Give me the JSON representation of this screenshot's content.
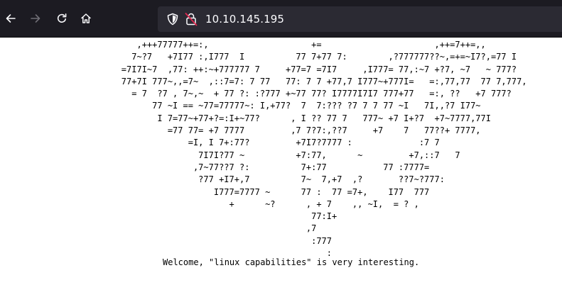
{
  "browser": {
    "url": "10.10.145.195",
    "icons": {
      "back": "arrow-left-icon",
      "forward": "arrow-right-icon",
      "reload": "reload-icon",
      "home": "home-icon",
      "tracking_protection": "shield-icon",
      "connection": "insecure-lock-icon"
    },
    "colors": {
      "toolbar_bg": "#1c1b22",
      "urlbar_bg": "#2b2a33",
      "icon": "#fbfbfe",
      "forward_disabled": "#6f6e75",
      "insecure_accent": "#e22850"
    }
  },
  "page": {
    "ascii_art": [
      "           ,+++77777++=:,                    +=                      ,++=7++=,,",
      "          7~?7   +7I77 :,I777  I          77 7+77 7:        ,?777777??~,=+=~I7?,=77 I",
      "        =7I7I~7  ,77: ++:~+777777 7     +77=7 =7I7     ,I777= 77,:~7 +?7, ~7   ~ 777?",
      "        77+7I 777~,,=7~  ,::7=7: 7 77   77: 7 7 +77,7 I777~+777I=   =:,77,77  77 7,777,",
      "          = 7  ?7 , 7~,~  + 77 ?: :?777 +~77 77? I7777I7I7 777+77   =:, ??   +7 777?",
      "              77 ~I == ~77=77777~: I,+77?  7  7:??? ?7 7 7 77 ~I   7I,,?7 I77~",
      "               I 7=77~+77+?=:I+~77?      , I ?? 77 7   777~ +7 I+?7  +7~7777,77I",
      "                 =77 77= +7 7777         ,7 7?7:,??7     +7    7   77??+ 7777,",
      "                     =I, I 7+:77?         +7I7?7777 :             :7 7",
      "                       7I7I?77 ~          +7:77,      ~         +7,::7   7",
      "                      ,7~77??7 ?:          7+:77           77 :7777=",
      "                       ?77 +I7+,7          7~  7,+7  ,?       ??7~?777:",
      "                          I777=7777 ~      77 :  77 =7+,    I77  777",
      "                             +      ~?      , + 7    ,, ~I,  = ? ,",
      "                                             77:I+",
      "                                            ,7",
      "                                             :777",
      "                                                :"
    ],
    "welcome_message": "Welcome, \"linux capabilities\" is very interesting."
  }
}
